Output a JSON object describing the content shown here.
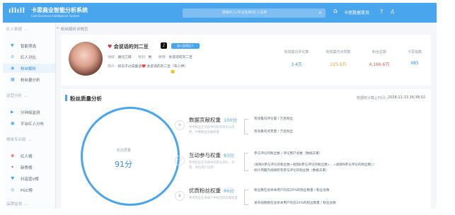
{
  "topbar": {
    "logo": "ıllıll",
    "brand": "卡思商业智能分析系统",
    "brand_sub": "Cast Business Intelligence System",
    "search_placeholder": "搜索红人/平台名称/红人名称",
    "home_label": "卡思数据首页"
  },
  "sidebar": {
    "sections": [
      "红人数据",
      "运营分析",
      "榜单专业版",
      "品牌监测"
    ],
    "items": [
      {
        "icon": "▼",
        "label": "智能筛选"
      },
      {
        "icon": "⊘",
        "label": "红人对比"
      },
      {
        "icon": "◉",
        "label": "粉丝解析"
      },
      {
        "icon": "▦",
        "label": "粉丝量分析"
      },
      {
        "icon": "▶",
        "label": "分钟级监测"
      },
      {
        "icon": "▣",
        "label": "平台红人分布"
      },
      {
        "icon": "♚",
        "label": "红人榜"
      },
      {
        "icon": "✦",
        "label": "新秀榜"
      },
      {
        "icon": "♥",
        "label": "抖音蓝V榜"
      },
      {
        "icon": "◎",
        "label": "PGC榜"
      }
    ]
  },
  "breadcrumb": "粉丝解析详情页",
  "profile": {
    "name": "会说话的刘二豆",
    "badge": "加入监测达人",
    "meta_location_label": "地域：",
    "meta_location": "湖北江城",
    "meta_gender_label": "性别：",
    "meta_gender": "男",
    "meta_platform_label": "微博：",
    "meta_platform": "会说话的刘二豆",
    "intro_label": "简介：",
    "intro": "抓日子过成童话❤️ 会说话的刘二豆（布小伊）",
    "stats": [
      {
        "label": "有效集均评论数",
        "value": "3.4万",
        "color": "#3b8fd6"
      },
      {
        "label": "有效集均点赞数",
        "value": "225.6万",
        "color": "#e9a23b"
      },
      {
        "label": "粉丝总数",
        "value": "4,166.6万",
        "color": "#e45a5a"
      },
      {
        "label": "卡思指数",
        "value": "985",
        "color": "#3b8fd6"
      }
    ]
  },
  "quality": {
    "title": "粉丝质量分析",
    "time_label": "数据统计截止时间：",
    "time": "2018-11-13 16:38:02",
    "gauge_label": "粉丝质量",
    "gauge_score": "91分",
    "gauge_fraction": 0.91,
    "metrics": [
      {
        "title": "数据贡献权重",
        "score": "100分",
        "desc": "参考粉丝在内容中的有效评论与点赞，计算粉丝贡献权重",
        "lines": [
          "有效集均评论量 / 万名粉丝",
          "有效集均点赞量 / 万名粉丝"
        ]
      },
      {
        "title": "互动参与权重",
        "score": "83分",
        "desc": "参考粉丝在内容中的参与评论、点赞、评论用户比例",
        "lines": [
          "参与评论的粉丝数 / 评论用户总数（数据去重）",
          "(视频A参与评论的粉丝数+视频B参与评论的粉丝数+...+视频N参与评论的粉丝数) /",
          "统计周期内视频所有参与评论的粉丝数（数据去重）"
        ]
      },
      {
        "title": "优质粉丝权重",
        "score": "86分",
        "desc": "参考粉丝在本账户中的活跃贡献程度",
        "lines": [
          "粉丝数在总体本用户的前20%的粉丝数量 / 粉丝总数",
          "发布视频数在总体本用户的前20%的粉丝数量 / 粉丝总数"
        ]
      }
    ]
  }
}
